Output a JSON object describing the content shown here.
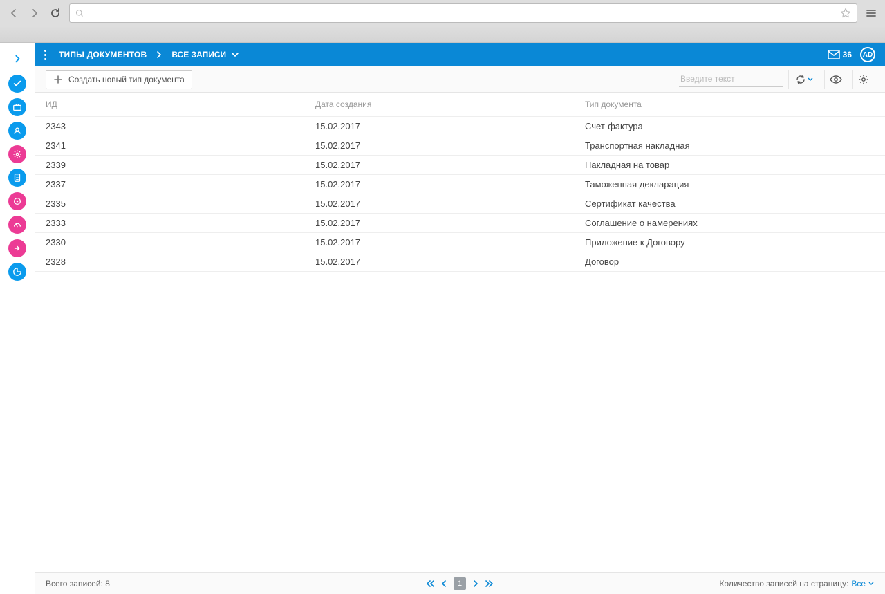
{
  "header": {
    "title": "ТИПЫ ДОКУМЕНТОВ",
    "subtitle": "ВСЕ ЗАПИСИ",
    "mail_count": "36",
    "avatar": "AD"
  },
  "toolbar": {
    "create_label": "Создать новый тип документа",
    "search_placeholder": "Введите текст"
  },
  "table": {
    "headers": {
      "id": "ИД",
      "date": "Дата создания",
      "type": "Тип документа"
    },
    "rows": [
      {
        "id": "2343",
        "date": "15.02.2017",
        "type": "Счет-фактура"
      },
      {
        "id": "2341",
        "date": "15.02.2017",
        "type": "Транспортная накладная"
      },
      {
        "id": "2339",
        "date": "15.02.2017",
        "type": "Накладная на товар"
      },
      {
        "id": "2337",
        "date": "15.02.2017",
        "type": "Таможенная декларация"
      },
      {
        "id": "2335",
        "date": "15.02.2017",
        "type": "Сертификат качества"
      },
      {
        "id": "2333",
        "date": "15.02.2017",
        "type": "Соглашение о намерениях"
      },
      {
        "id": "2330",
        "date": "15.02.2017",
        "type": "Приложение к Договору"
      },
      {
        "id": "2328",
        "date": "15.02.2017",
        "type": "Договор"
      }
    ]
  },
  "footer": {
    "total_label": "Всего записей: 8",
    "page": "1",
    "per_page_label": "Количество записей на страницу: ",
    "per_page_value": "Все"
  }
}
